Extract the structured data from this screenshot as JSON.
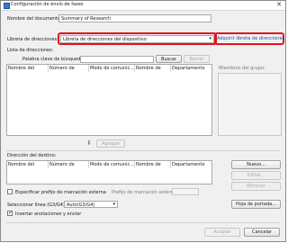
{
  "window": {
    "title": "Configuración de envío de faxes",
    "close_glyph": "✕"
  },
  "doc_name": {
    "label": "Nombre del documento:",
    "value": "Summary of Research"
  },
  "address_book": {
    "label": "Libreta de direcciones:",
    "selected": "Libreta de direcciones del dispositivo",
    "add_button": "Adquirir libreta de direcciones"
  },
  "address_list": {
    "label": "Lista de direcciones:",
    "search_placeholder": "Palabra clave de búsqueda:",
    "search_button": "Buscar",
    "delete_button": "Borrar",
    "columns": [
      "Nombre del destino",
      "Número de fax/URI",
      "Modo de comunic...",
      "Nombre de em...",
      "Departamento"
    ],
    "group_members_label": "Miembros del grupo:"
  },
  "add_action": {
    "arrow": "⬇",
    "label": "Agregar"
  },
  "destination": {
    "label": "Dirección del destino:",
    "columns": [
      "Nombre del destino",
      "Número de fax/URI",
      "Modo de comunic...",
      "Nombre de em...",
      "Departamento"
    ],
    "buttons": {
      "new": "Nuevo...",
      "edit": "Editar...",
      "delete": "Eliminar",
      "cover": "Hoja de portada..."
    }
  },
  "options": {
    "external_prefix_label": "Especificar prefijo de marcación externa",
    "external_prefix_field_label": "Prefijo de marcación externa:",
    "select_line_label": "Seleccionar línea (G3/G4):",
    "select_line_value": "Auto(G3/G4)",
    "insert_annotations_label": "Insertar anotaciones y enviar"
  },
  "footer": {
    "accept": "Aceptar",
    "cancel": "Cancelar"
  }
}
